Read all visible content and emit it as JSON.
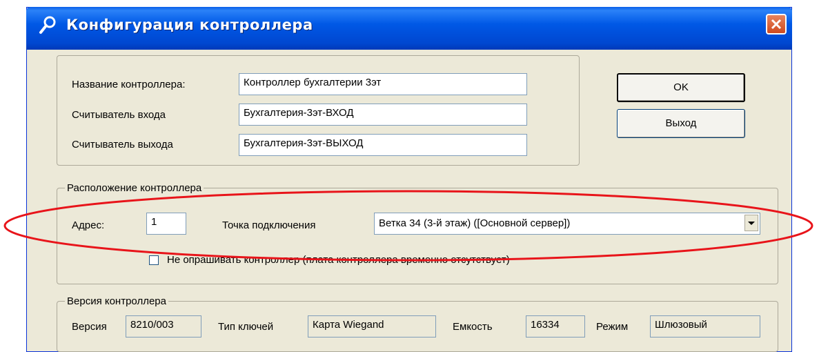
{
  "window": {
    "title": "Конфигурация контроллера"
  },
  "names_group": {
    "rows": [
      {
        "label": "Название контроллера:",
        "value": "Контроллер бухгалтерии 3эт"
      },
      {
        "label": "Считыватель входа",
        "value": "Бухгалтерия-3эт-ВХОД"
      },
      {
        "label": "Считыватель выхода",
        "value": "Бухгалтерия-3эт-ВЫХОД"
      }
    ]
  },
  "buttons": {
    "ok": "OK",
    "exit": "Выход"
  },
  "location": {
    "title": "Расположение контроллера",
    "address_label": "Адрес:",
    "address_value": "1",
    "connection_label": "Точка подключения",
    "connection_value": "Ветка 34 (3-й этаж) ([Основной сервер])",
    "no_poll_label": "Не опрашивать контроллер  (плата контроллера временно отсутствует)",
    "no_poll_checked": false
  },
  "version": {
    "title": "Версия контроллера",
    "version_label": "Версия",
    "version_value": "8210/003",
    "keytype_label": "Тип ключей",
    "keytype_value": "Карта Wiegand",
    "capacity_label": "Емкость",
    "capacity_value": "16334",
    "mode_label": "Режим",
    "mode_value": "Шлюзовый"
  },
  "colors": {
    "highlight_ellipse": "#e8141a",
    "title_bar": "#0054e3"
  }
}
